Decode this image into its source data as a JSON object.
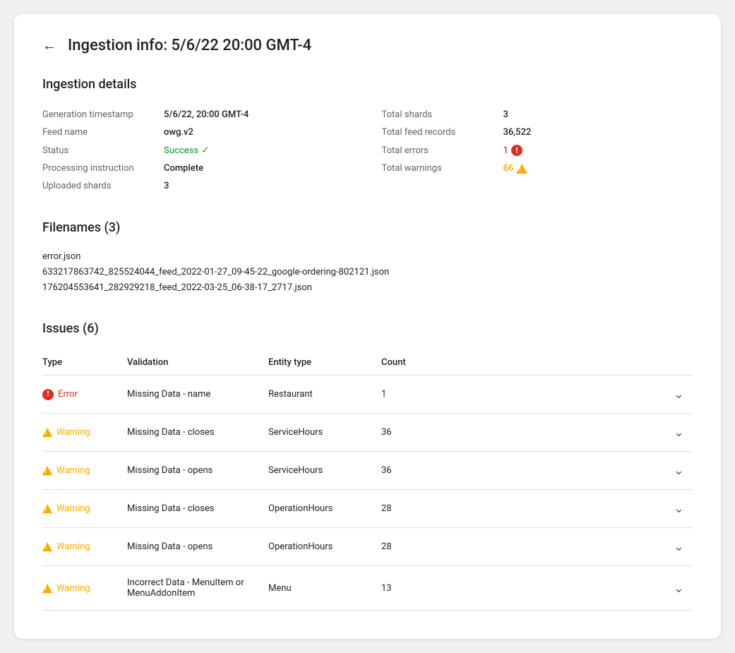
{
  "page": {
    "title": "Ingestion info: 5/6/22 20:00 GMT-4"
  },
  "ingestion_details": {
    "section_title": "Ingestion details",
    "left": [
      {
        "label": "Generation timestamp",
        "value": "5/6/22, 20:00 GMT-4",
        "bold": true
      },
      {
        "label": "Feed name",
        "value": "owg.v2",
        "bold": true
      },
      {
        "label": "Status",
        "value": "Success",
        "type": "success"
      },
      {
        "label": "Processing instruction",
        "value": "Complete",
        "bold": true
      },
      {
        "label": "Uploaded shards",
        "value": "3",
        "bold": true
      }
    ],
    "right": [
      {
        "label": "Total shards",
        "value": "3",
        "bold": true
      },
      {
        "label": "Total feed records",
        "value": "36,522",
        "bold": true
      },
      {
        "label": "Total errors",
        "value": "1",
        "type": "error"
      },
      {
        "label": "Total warnings",
        "value": "66",
        "type": "warning"
      }
    ]
  },
  "filenames": {
    "section_title": "Filenames (3)",
    "files": [
      "error.json",
      "633217863742_825524044_feed_2022-01-27_09-45-22_google-ordering-802121.json",
      "176204553641_282929218_feed_2022-03-25_06-38-17_2717.json"
    ]
  },
  "issues": {
    "section_title": "Issues (6)",
    "columns": [
      "Type",
      "Validation",
      "Entity type",
      "Count"
    ],
    "rows": [
      {
        "type": "Error",
        "type_kind": "error",
        "validation": "Missing Data - name",
        "entity_type": "Restaurant",
        "count": "1"
      },
      {
        "type": "Warning",
        "type_kind": "warning",
        "validation": "Missing Data - closes",
        "entity_type": "ServiceHours",
        "count": "36"
      },
      {
        "type": "Warning",
        "type_kind": "warning",
        "validation": "Missing Data - opens",
        "entity_type": "ServiceHours",
        "count": "36"
      },
      {
        "type": "Warning",
        "type_kind": "warning",
        "validation": "Missing Data - closes",
        "entity_type": "OperationHours",
        "count": "28"
      },
      {
        "type": "Warning",
        "type_kind": "warning",
        "validation": "Missing Data - opens",
        "entity_type": "OperationHours",
        "count": "28"
      },
      {
        "type": "Warning",
        "type_kind": "warning",
        "validation": "Incorrect Data - MenuItem or MenuAddonItem",
        "entity_type": "Menu",
        "count": "13"
      }
    ]
  },
  "icons": {
    "back_arrow": "←",
    "chevron_down": "∨"
  }
}
